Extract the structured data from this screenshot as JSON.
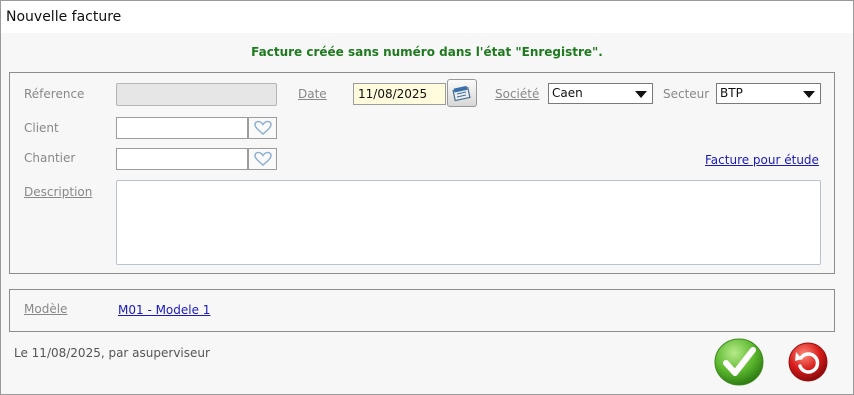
{
  "window": {
    "title": "Nouvelle facture"
  },
  "status_message": "Facture créée sans numéro dans l'état \"Enregistre\".",
  "form": {
    "reference": {
      "label": "Réference",
      "value": ""
    },
    "date": {
      "label": "Date",
      "value": "11/08/2025"
    },
    "societe": {
      "label": "Société",
      "value": "Caen"
    },
    "secteur": {
      "label": "Secteur",
      "value": "BTP"
    },
    "client": {
      "label": "Client",
      "value": ""
    },
    "chantier": {
      "label": "Chantier",
      "value": ""
    },
    "description": {
      "label": "Description",
      "value": ""
    },
    "study_link": "Facture pour étude"
  },
  "model": {
    "label": "Modèle",
    "value": "M01 - Modele 1"
  },
  "footer": {
    "audit": "Le 11/08/2025, par asuperviseur"
  },
  "icons": {
    "calendar": "calendar-icon",
    "heart": "heart-icon",
    "validate": "checkmark-icon",
    "cancel": "undo-icon"
  },
  "colors": {
    "status_green": "#1f7a1f",
    "link_blue": "#1a1ab8",
    "date_bg": "#fffbdc",
    "validate_green": "#5cb82e",
    "cancel_red": "#d61a1a"
  }
}
